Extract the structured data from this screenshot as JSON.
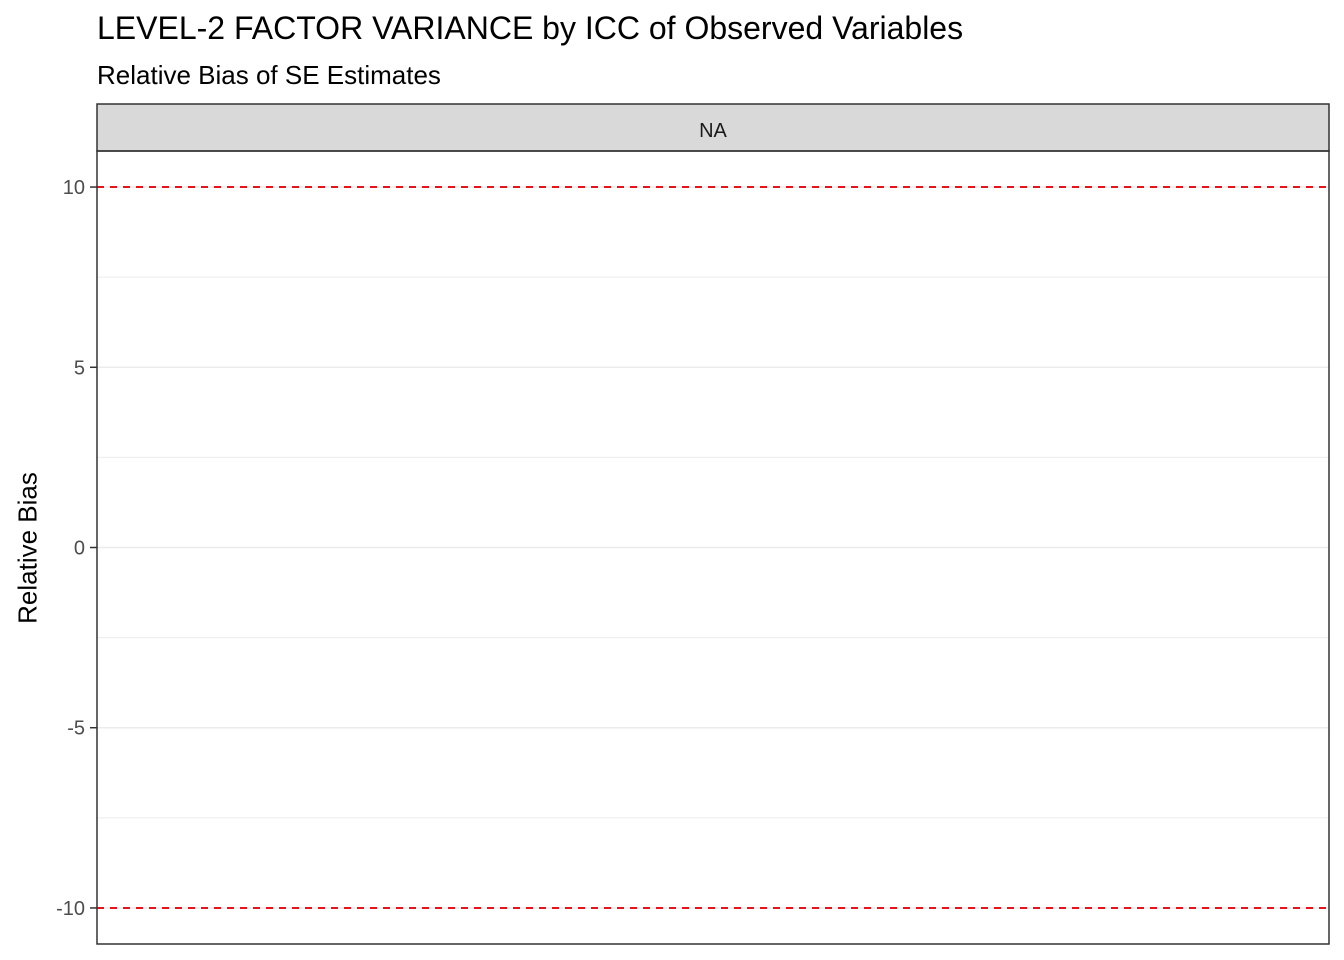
{
  "chart_data": {
    "type": "line",
    "title": "LEVEL-2 FACTOR VARIANCE by ICC of Observed Variables",
    "subtitle": "Relative Bias of SE Estimates",
    "xlabel": "",
    "ylabel": "Relative Bias",
    "facet_label": "NA",
    "ylim": [
      -11,
      11
    ],
    "y_ticks": [
      10,
      5,
      0,
      -5,
      -10
    ],
    "y_minor_ticks": [
      7.5,
      2.5,
      -2.5,
      -7.5
    ],
    "y_tick_labels": [
      "10",
      "5",
      "0",
      "-5",
      "-10"
    ],
    "reference_lines": [
      {
        "y": 10,
        "style": "dashed",
        "color": "#e8121b"
      },
      {
        "y": -10,
        "style": "dashed",
        "color": "#e8121b"
      }
    ],
    "series": [],
    "grid": true
  }
}
